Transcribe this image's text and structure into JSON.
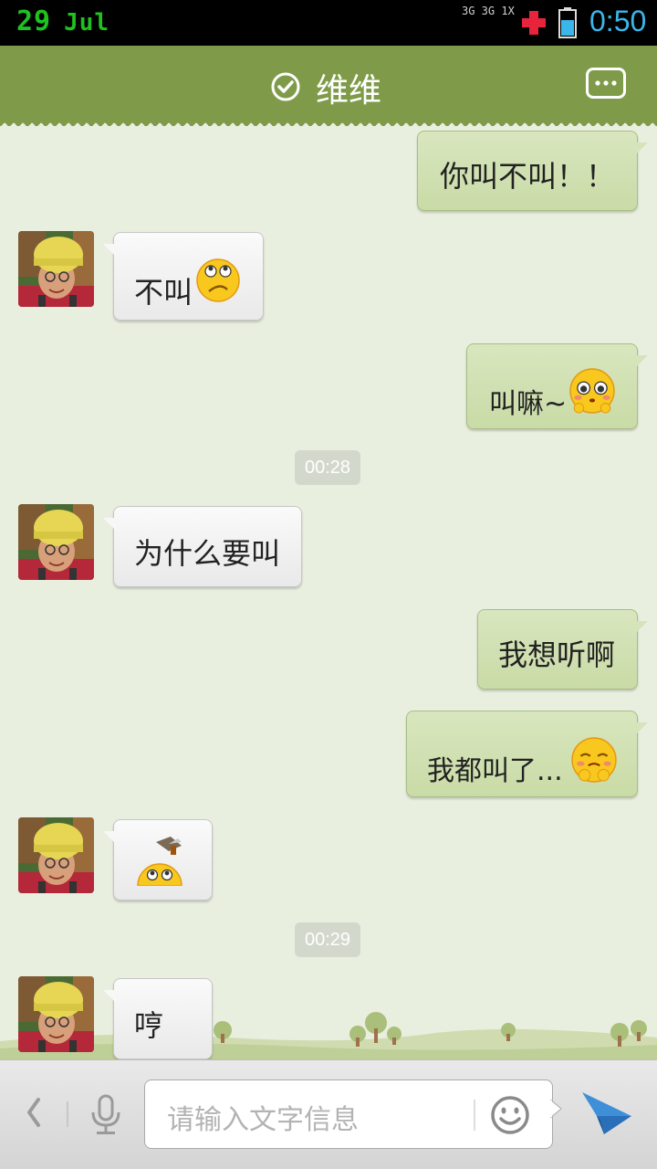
{
  "status_bar": {
    "day": "29",
    "month": "Jul",
    "network": "3G 3G 1X",
    "time": "0:50"
  },
  "header": {
    "title": "维维",
    "verified_icon": "check-circle-icon",
    "menu_icon": "more-dots-icon"
  },
  "messages": [
    {
      "side": "out",
      "text": "你叫不叫！！",
      "emoji": ""
    },
    {
      "side": "in",
      "text": "不叫",
      "emoji": "rolling-eyes-emoji"
    },
    {
      "side": "out",
      "text": "叫嘛~",
      "emoji": "pleading-emoji"
    },
    {
      "side": "time",
      "text": "00:28"
    },
    {
      "side": "in",
      "text": "为什么要叫",
      "emoji": ""
    },
    {
      "side": "out",
      "text": "我想听啊",
      "emoji": ""
    },
    {
      "side": "out",
      "text": "我都叫了...",
      "emoji": "shy-emoji"
    },
    {
      "side": "in",
      "text": "",
      "emoji": "hammer-emoji"
    },
    {
      "side": "time",
      "text": "00:29"
    },
    {
      "side": "in",
      "text": "哼",
      "emoji": ""
    }
  ],
  "input_bar": {
    "placeholder": "请输入文字信息",
    "icons": [
      "back-chevron-icon",
      "microphone-icon",
      "smiley-icon",
      "send-paper-plane-icon"
    ]
  },
  "colors": {
    "header": "#7f9b4a",
    "outgoing_bubble": "#d2e1b4",
    "incoming_bubble": "#f4f4f4",
    "background": "#e9efdf",
    "status_date": "#1fc21f",
    "status_time": "#3ab6ea"
  }
}
